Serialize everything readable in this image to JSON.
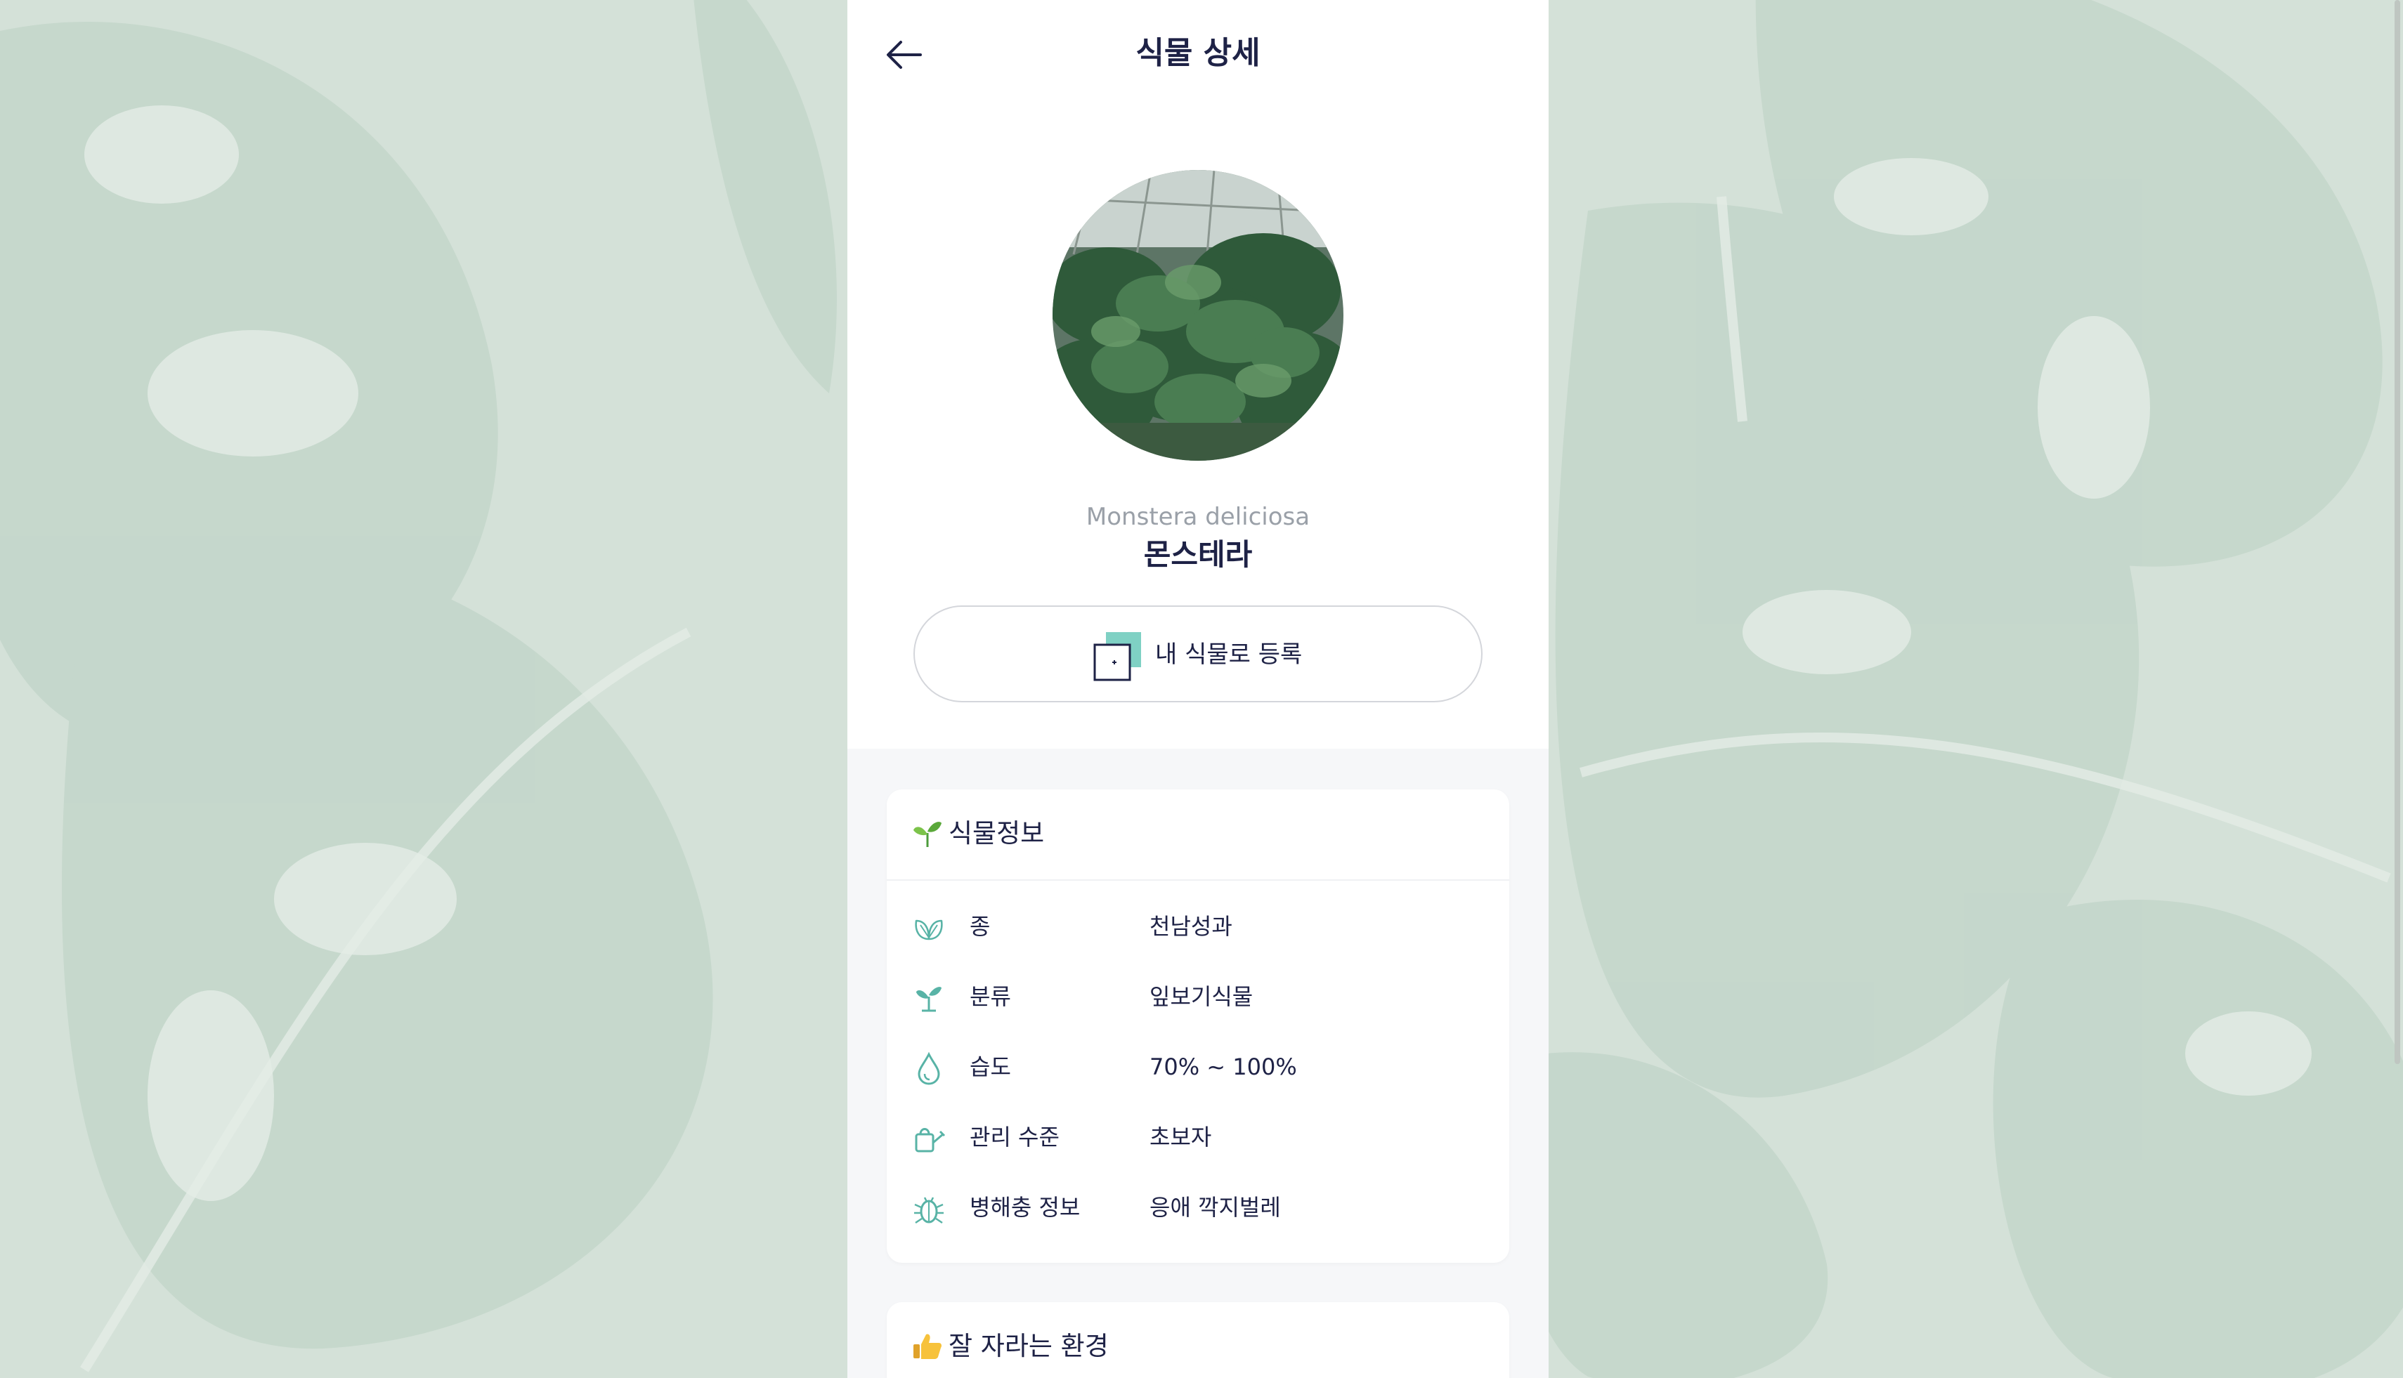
{
  "header": {
    "title": "식물 상세",
    "back_icon": "arrow-left-icon"
  },
  "plant": {
    "scientific_name": "Monstera deliciosa",
    "korean_name": "몬스테라",
    "photo_alt": "monstera-photo"
  },
  "register_button": {
    "label": "내 식물로 등록",
    "icon": "add-square-icon"
  },
  "info_card": {
    "title": "식물정보",
    "title_icon": "seedling-icon",
    "rows": [
      {
        "icon": "leaf-icon",
        "label": "종",
        "value": "천남성과"
      },
      {
        "icon": "sprout-icon",
        "label": "분류",
        "value": "잎보기식물"
      },
      {
        "icon": "water-drop-icon",
        "label": "습도",
        "value": "70% ~ 100%"
      },
      {
        "icon": "watering-can-icon",
        "label": "관리 수준",
        "value": "초보자"
      },
      {
        "icon": "bug-icon",
        "label": "병해충 정보",
        "value": "응애 깍지벌레"
      }
    ]
  },
  "env_card": {
    "title": "잘 자라는 환경",
    "title_icon": "thumbs-up-icon"
  },
  "colors": {
    "accent": "#58b3a6",
    "title": "#1e2246",
    "background": "#d3e0d7"
  }
}
